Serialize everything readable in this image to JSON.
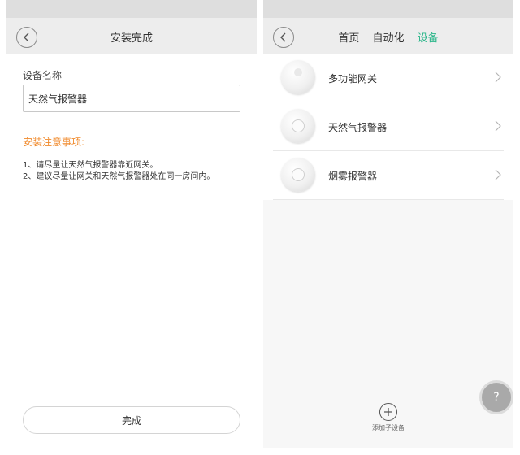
{
  "left_screen": {
    "title": "安装完成",
    "field_label": "设备名称",
    "device_name_value": "天然气报警器",
    "notes_title": "安装注意事项:",
    "notes": [
      "1、请尽量让天然气报警器靠近网关。",
      "2、建议尽量让网关和天然气报警器处在同一房间内。"
    ],
    "done_label": "完成"
  },
  "right_screen": {
    "tabs": [
      {
        "label": "首页",
        "active": false
      },
      {
        "label": "自动化",
        "active": false
      },
      {
        "label": "设备",
        "active": true
      }
    ],
    "devices": [
      {
        "name": "多功能网关",
        "icon": "gateway-device-icon"
      },
      {
        "name": "天然气报警器",
        "icon": "gas-alarm-device-icon"
      },
      {
        "name": "烟雾报警器",
        "icon": "smoke-alarm-device-icon"
      }
    ],
    "add_label": "添加子设备"
  },
  "help_label": "?",
  "colors": {
    "accent_green": "#2bb68a",
    "notes_orange": "#f08a2c"
  }
}
